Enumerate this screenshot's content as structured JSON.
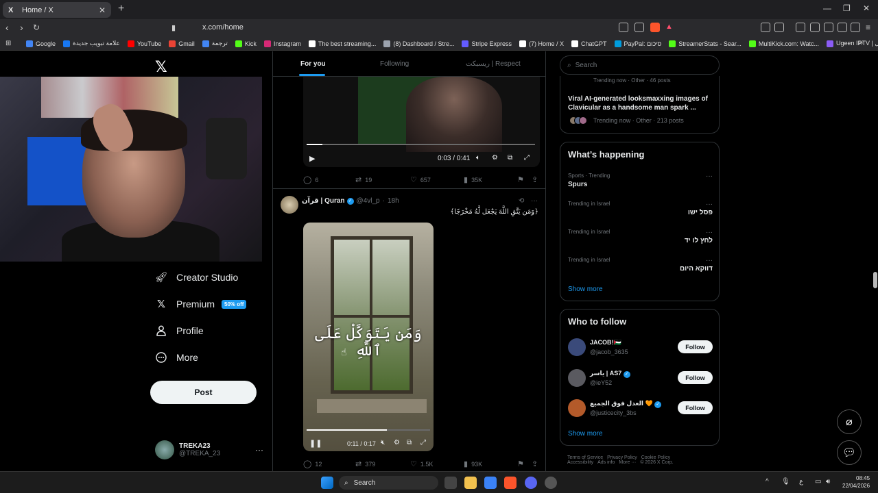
{
  "browser": {
    "tab_title": "Home / X",
    "tab_favicon": "X",
    "url": "x.com/home",
    "bookmarks": [
      {
        "label": "Google",
        "color": "#4285f4"
      },
      {
        "label": "علامة تبويب جديدة",
        "color": "#1877f2"
      },
      {
        "label": "YouTube",
        "color": "#ff0000"
      },
      {
        "label": "Gmail",
        "color": "#ea4335"
      },
      {
        "label": "ترجمة",
        "color": "#4285f4"
      },
      {
        "label": "Kick",
        "color": "#53fc18"
      },
      {
        "label": "Instagram",
        "color": "#d62976"
      },
      {
        "label": "The best streaming...",
        "color": "#ffffff"
      },
      {
        "label": "(8) Dashboard / Stre...",
        "color": "#9ca3af"
      },
      {
        "label": "Stripe Express",
        "color": "#635bff"
      },
      {
        "label": "(7) Home / X",
        "color": "#ffffff"
      },
      {
        "label": "ChatGPT",
        "color": "#ffffff"
      },
      {
        "label": "PayPal: סיכום",
        "color": "#009cde"
      },
      {
        "label": "StreamerStats - Sear...",
        "color": "#53fc18"
      },
      {
        "label": "MultiKick.com: Watc...",
        "color": "#53fc18"
      },
      {
        "label": "Ugeen IPTV | تسجيل...",
        "color": "#8b5cf6"
      }
    ]
  },
  "sidebar": {
    "items": [
      {
        "label": "Creator Studio",
        "icon": "creator-studio-icon"
      },
      {
        "label": "Premium",
        "icon": "x-premium-icon",
        "badge": "50% off"
      },
      {
        "label": "Profile",
        "icon": "profile-icon"
      },
      {
        "label": "More",
        "icon": "more-circle-icon"
      }
    ],
    "post_label": "Post",
    "account": {
      "name": "TREKA23",
      "handle": "@TREKA_23"
    }
  },
  "feed": {
    "tabs": [
      "For you",
      "Following",
      "ريسبكت | Respect"
    ],
    "tweet1": {
      "video_time": "0:03 / 0:41",
      "progress": 0.07,
      "replies": "6",
      "reposts": "19",
      "likes": "657",
      "views": "35K"
    },
    "tweet2": {
      "name": "قرآن | Quran",
      "handle": "@4vl_p",
      "time": "18h",
      "text": "﴿وَمَن يَتَّقِ اللَّهَ يَجْعَل لَّهُ مَخْرَجًا﴾",
      "overlay": "وَمَن يَتَوَكَّلْ عَلَى ٱللَّهِ",
      "video_time": "0:11 / 0:17",
      "progress": 0.65,
      "replies": "12",
      "reposts": "379",
      "likes": "1.5K",
      "views": "93K"
    }
  },
  "right": {
    "search_placeholder": "Search",
    "top_card": {
      "cut_text": "Trending now · Other · 46 posts",
      "headline": "Viral AI-generated looksmaxxing images of Clavicular as a handsome man spark ...",
      "meta": "Trending now · Other · 213 posts"
    },
    "happening_title": "What’s happening",
    "trends": [
      {
        "context": "Sports · Trending",
        "topic": "Spurs",
        "rtl": false
      },
      {
        "context": "Trending in Israel",
        "topic": "פסל ישו",
        "rtl": true
      },
      {
        "context": "Trending in Israel",
        "topic": "לחץ לו יד",
        "rtl": true
      },
      {
        "context": "Trending in Israel",
        "topic": "דווקא היום",
        "rtl": true
      }
    ],
    "show_more": "Show more",
    "who_title": "Who to follow",
    "follow_label": "Follow",
    "suggestions": [
      {
        "name": "JACOB!🇵🇸",
        "handle": "@jacob_3635",
        "verified": false,
        "color": "#3a4a7a"
      },
      {
        "name": "ياسر | AS7",
        "handle": "@ieY52",
        "verified": true,
        "color": "#5a5a60"
      },
      {
        "name": "العدل فوق الجميع 🧡",
        "handle": "@justicecity_3bs",
        "verified": true,
        "color": "#b35a2a"
      }
    ],
    "footer": [
      "Terms of Service",
      "Privacy Policy",
      "Cookie Policy",
      "Accessibility",
      "Ads info",
      "More ···",
      "© 2026 X Corp."
    ]
  },
  "taskbar": {
    "search_label": "Search",
    "time": "08:45",
    "date": "22/04/2026",
    "lang": "ع"
  }
}
